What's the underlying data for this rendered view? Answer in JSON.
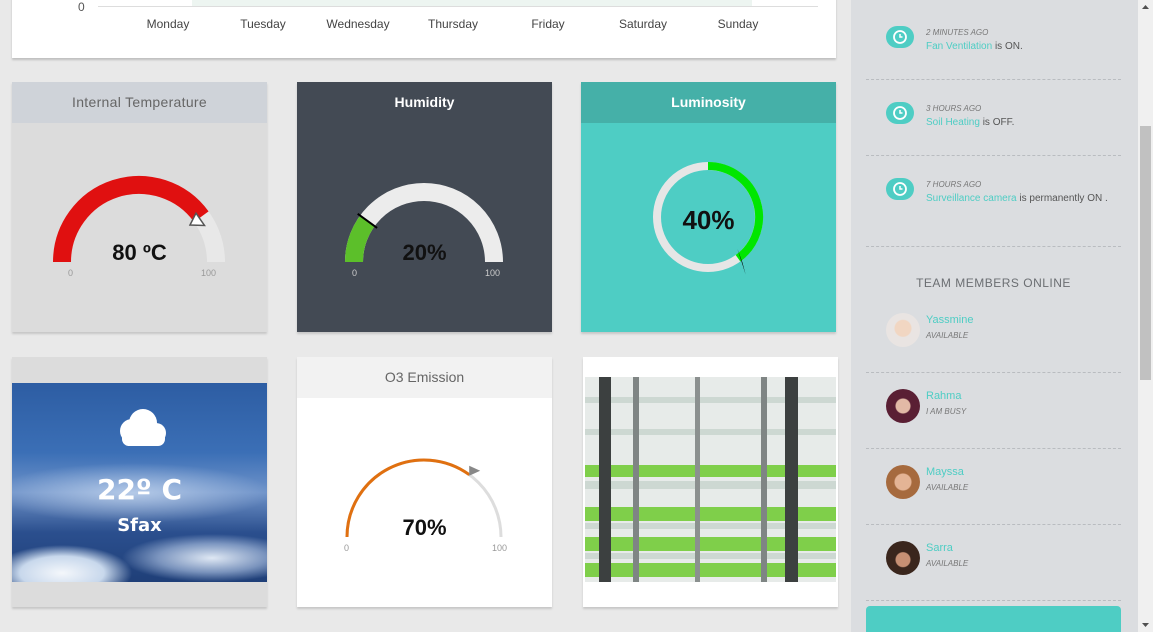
{
  "chart": {
    "zero_label": "0",
    "days": [
      "Monday",
      "Tuesday",
      "Wednesday",
      "Thursday",
      "Friday",
      "Saturday",
      "Sunday"
    ]
  },
  "gauges": {
    "temperature": {
      "title": "Internal Temperature",
      "value_text": "80 ºC",
      "value": 80,
      "min": "0",
      "max": "100",
      "color": "#e01010"
    },
    "humidity": {
      "title": "Humidity",
      "value_text": "20%",
      "value": 20,
      "min": "0",
      "max": "100",
      "color": "#5cbf2a"
    },
    "luminosity": {
      "title": "Luminosity",
      "value_text": "40%",
      "value": 40,
      "color": "#00e600"
    },
    "o3": {
      "title": "O3 Emission",
      "value_text": "70%",
      "value": 70,
      "min": "0",
      "max": "100",
      "color": "#e07010"
    }
  },
  "weather": {
    "temperature": "22º C",
    "city": "Sfax",
    "icon": "cloud-icon"
  },
  "activity": [
    {
      "time": "2 MINUTES AGO",
      "link": "Fan Ventilation",
      "text": " is ON."
    },
    {
      "time": "3 HOURS AGO",
      "link": "Soil Heating",
      "text": " is OFF."
    },
    {
      "time": "7 HOURS AGO",
      "link": "Surveillance camera",
      "text": " is permanently ON ."
    }
  ],
  "team": {
    "title": "TEAM MEMBERS ONLINE",
    "members": [
      {
        "name": "Yassmine",
        "status": "AVAILABLE"
      },
      {
        "name": "Rahma",
        "status": "I AM BUSY"
      },
      {
        "name": "Mayssa",
        "status": "AVAILABLE"
      },
      {
        "name": "Sarra",
        "status": "AVAILABLE"
      }
    ]
  },
  "colors": {
    "accent": "#4ecdc4",
    "dark_card": "#434a54",
    "sidebar": "#dbdde0"
  }
}
